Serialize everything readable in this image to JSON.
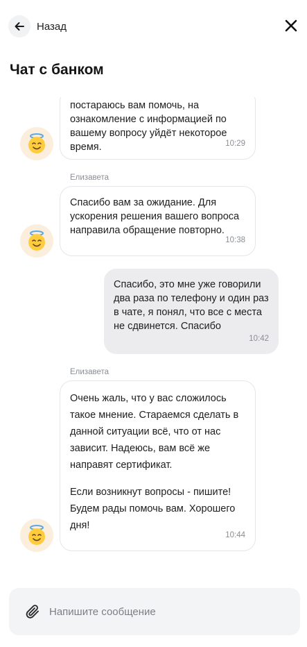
{
  "header": {
    "back_label": "Назад",
    "back_icon": "arrow-left-icon",
    "close_icon": "close-icon"
  },
  "page_title": "Чат с банком",
  "messages": [
    {
      "direction": "incoming",
      "sender": "",
      "text": "постараюсь вам помочь, на ознакомление с информацией по вашему вопросу уйдёт некоторое время.",
      "time": "10:29"
    },
    {
      "direction": "incoming",
      "sender": "Елизавета",
      "text": "Спасибо вам за ожидание. Для ускорения решения вашего вопроса направила обращение повторно.",
      "time": "10:38"
    },
    {
      "direction": "outgoing",
      "text": "Спасибо, это мне уже говорили два раза по телефону и один раз в чате, я понял, что все с места не сдвинется. Спасибо",
      "time": "10:42"
    },
    {
      "direction": "incoming",
      "sender": "Елизавета",
      "paragraphs": [
        "Очень жаль, что у вас сложилось такое мнение. Стараемся сделать в данной ситуации всё, что от нас зависит. Надеюсь, вам всё же направят сертификат.",
        "Если возникнут вопросы - пишите! Будем рады помочь вам. Хорошего дня!"
      ],
      "time": "10:44"
    }
  ],
  "avatar_icon": "angel-emoji-icon",
  "composer": {
    "placeholder": "Напишите сообщение",
    "value": "",
    "attach_icon": "paperclip-icon"
  },
  "colors": {
    "avatar_bg": "#fbeedc",
    "outgoing_bubble": "#ececee",
    "incoming_border": "#e4e6ea",
    "composer_bg": "#f3f4f6"
  }
}
